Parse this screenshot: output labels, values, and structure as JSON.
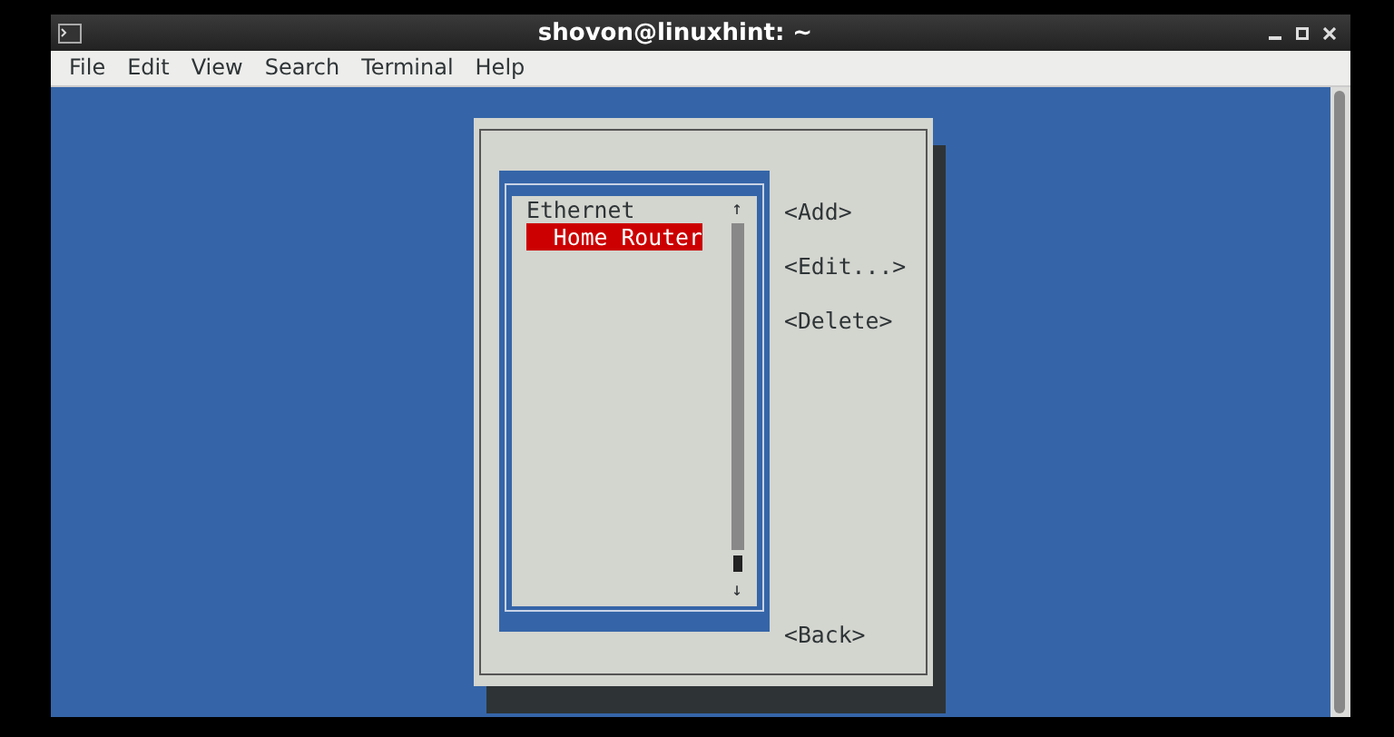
{
  "window": {
    "title": "shovon@linuxhint: ~"
  },
  "menu": [
    "File",
    "Edit",
    "View",
    "Search",
    "Terminal",
    "Help"
  ],
  "dialog": {
    "connections": [
      {
        "label": "Ethernet",
        "selected": false,
        "children": [
          {
            "label": "Home Router",
            "selected": true
          }
        ]
      }
    ],
    "scroll_up": "↑",
    "scroll_down": "↓",
    "buttons": [
      "<Add>",
      "<Edit...>",
      "<Delete>"
    ],
    "back_button": "<Back>"
  }
}
